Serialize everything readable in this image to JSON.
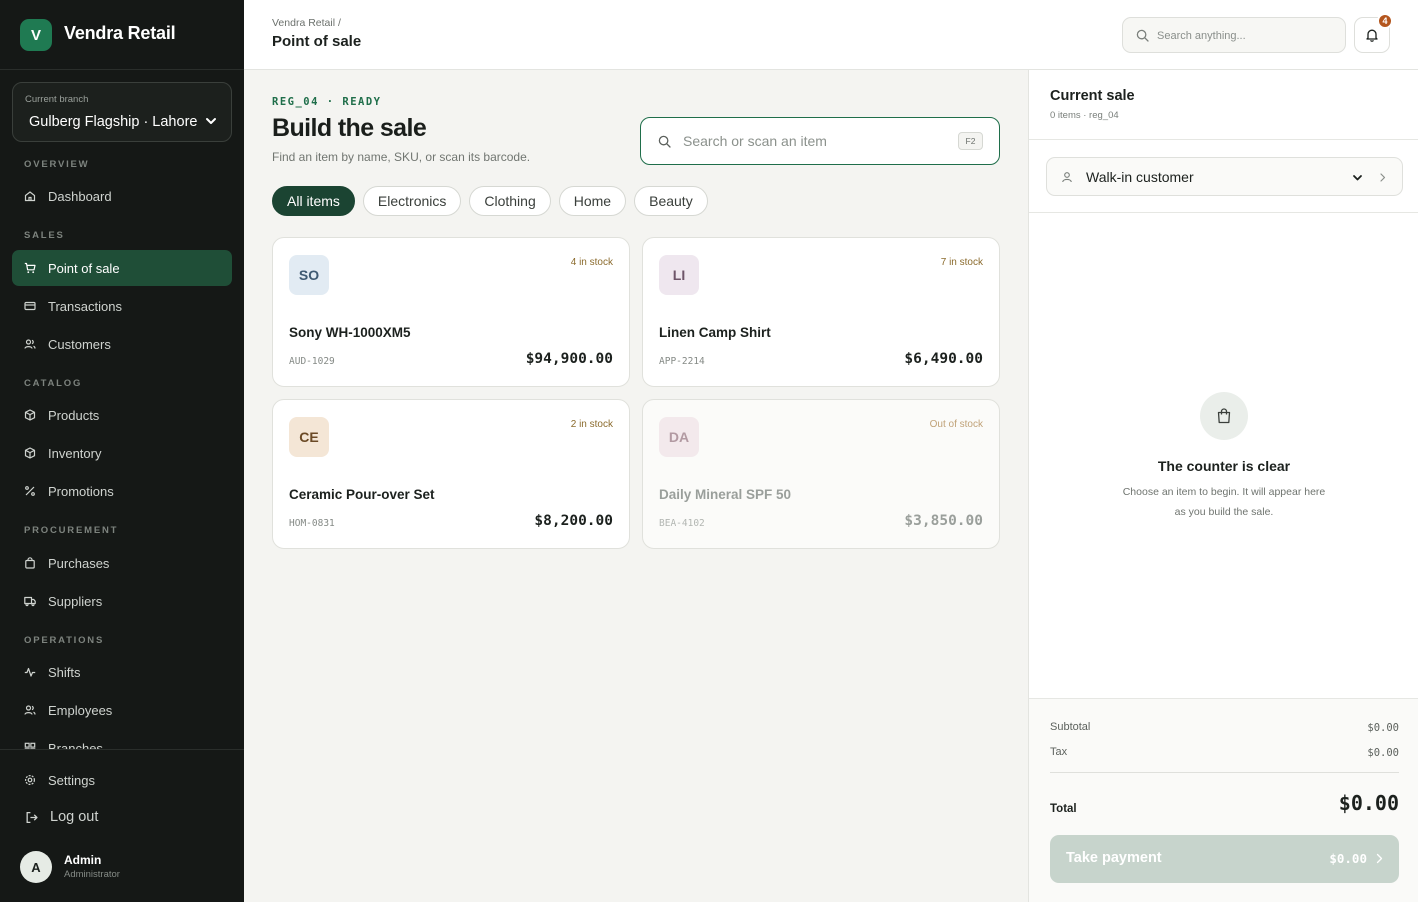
{
  "app": {
    "brand_initial": "V",
    "brand_name": "Vendra Retail"
  },
  "branch": {
    "label": "Current branch",
    "value": "Gulberg Flagship · Lahore"
  },
  "nav": {
    "overview": "OVERVIEW",
    "sales": "SALES",
    "catalog": "CATALOG",
    "procurement": "PROCUREMENT",
    "operations": "OPERATIONS",
    "dashboard": "Dashboard",
    "point_of_sale": "Point of sale",
    "transactions": "Transactions",
    "customers": "Customers",
    "products": "Products",
    "inventory": "Inventory",
    "promotions": "Promotions",
    "purchases": "Purchases",
    "suppliers": "Suppliers",
    "shifts": "Shifts",
    "employees": "Employees",
    "branches": "Branches",
    "settings": "Settings",
    "logout": "Log out"
  },
  "user": {
    "initial": "A",
    "name": "Admin",
    "role": "Administrator"
  },
  "header": {
    "breadcrumb": "Vendra Retail /",
    "title": "Point of sale",
    "search_placeholder": "Search anything...",
    "notification_count": "4"
  },
  "main": {
    "eyebrow": "REG_04 · READY",
    "title": "Build the sale",
    "subtitle": "Find an item by name, SKU, or scan its barcode.",
    "search_placeholder": "Search or scan an item",
    "search_shortcut": "F2",
    "filters": [
      "All items",
      "Electronics",
      "Clothing",
      "Home",
      "Beauty"
    ],
    "products": [
      {
        "initials": "SO",
        "name": "Sony WH-1000XM5",
        "sku": "AUD-1029",
        "price": "$94,900.00",
        "stock": "4 in stock",
        "thumb_bg": "#e2ebf3",
        "thumb_fg": "#3f5a72"
      },
      {
        "initials": "LI",
        "name": "Linen Camp Shirt",
        "sku": "APP-2214",
        "price": "$6,490.00",
        "stock": "7 in stock",
        "thumb_bg": "#efe7ef",
        "thumb_fg": "#6e5569"
      },
      {
        "initials": "CE",
        "name": "Ceramic Pour-over Set",
        "sku": "HOM-0831",
        "price": "$8,200.00",
        "stock": "2 in stock",
        "thumb_bg": "#f4e6d6",
        "thumb_fg": "#6b4a26"
      },
      {
        "initials": "DA",
        "name": "Daily Mineral SPF 50",
        "sku": "BEA-4102",
        "price": "$3,850.00",
        "stock": "Out of stock",
        "thumb_bg": "#f3e9ec",
        "thumb_fg": "#b29aa2"
      }
    ]
  },
  "sale": {
    "title": "Current sale",
    "meta": "0 items · reg_04",
    "customer": "Walk-in customer",
    "empty_title": "The counter is clear",
    "empty_text": "Choose an item to begin. It will appear here as you build the sale.",
    "subtotal_label": "Subtotal",
    "subtotal": "$0.00",
    "tax_label": "Tax",
    "tax": "$0.00",
    "total_label": "Total",
    "total": "$0.00",
    "pay_label": "Take payment",
    "pay_amount": "$0.00"
  },
  "colors": {
    "accent": "#1f6e4a",
    "sidebar_bg": "#151816",
    "active_nav": "#1f4e37",
    "badge": "#b4561e"
  }
}
